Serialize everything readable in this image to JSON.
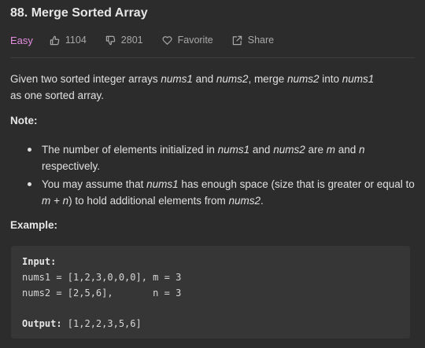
{
  "problem": {
    "title": "88. Merge Sorted Array",
    "difficulty": "Easy",
    "likes": "1104",
    "dislikes": "2801",
    "favorite_label": "Favorite",
    "share_label": "Share"
  },
  "description": {
    "line1_a": "Given two sorted integer arrays ",
    "nums1": "nums1",
    "line1_b": " and ",
    "nums2": "nums2",
    "line1_c": ", merge ",
    "line1_d": " into ",
    "line1_e": " as one sorted array."
  },
  "note": {
    "heading": "Note:",
    "item1_a": "The number of elements initialized in ",
    "item1_b": " and ",
    "item1_c": " are ",
    "m": "m",
    "item1_d": " and ",
    "n": "n",
    "item1_e": " respectively.",
    "item2_a": "You may assume that ",
    "item2_b": " has enough space (size that is greater or equal to ",
    "m_plus_n": "m + n",
    "item2_c": ") to hold additional elements from ",
    "item2_d": "."
  },
  "example": {
    "heading": "Example:",
    "input_label": "Input:",
    "line1": "nums1 = [1,2,3,0,0,0], m = 3",
    "line2": "nums2 = [2,5,6],       n = 3",
    "output_label": "Output:",
    "output_value": " [1,2,2,3,5,6]"
  },
  "colors": {
    "background": "#2c2c2c",
    "code_background": "#363636",
    "difficulty_easy": "#e48ddf",
    "text": "#e0e0e0",
    "muted": "#a8a8a8"
  },
  "icons": {
    "like": "thumbs-up-icon",
    "dislike": "thumbs-down-icon",
    "favorite": "heart-icon",
    "share": "share-icon"
  }
}
